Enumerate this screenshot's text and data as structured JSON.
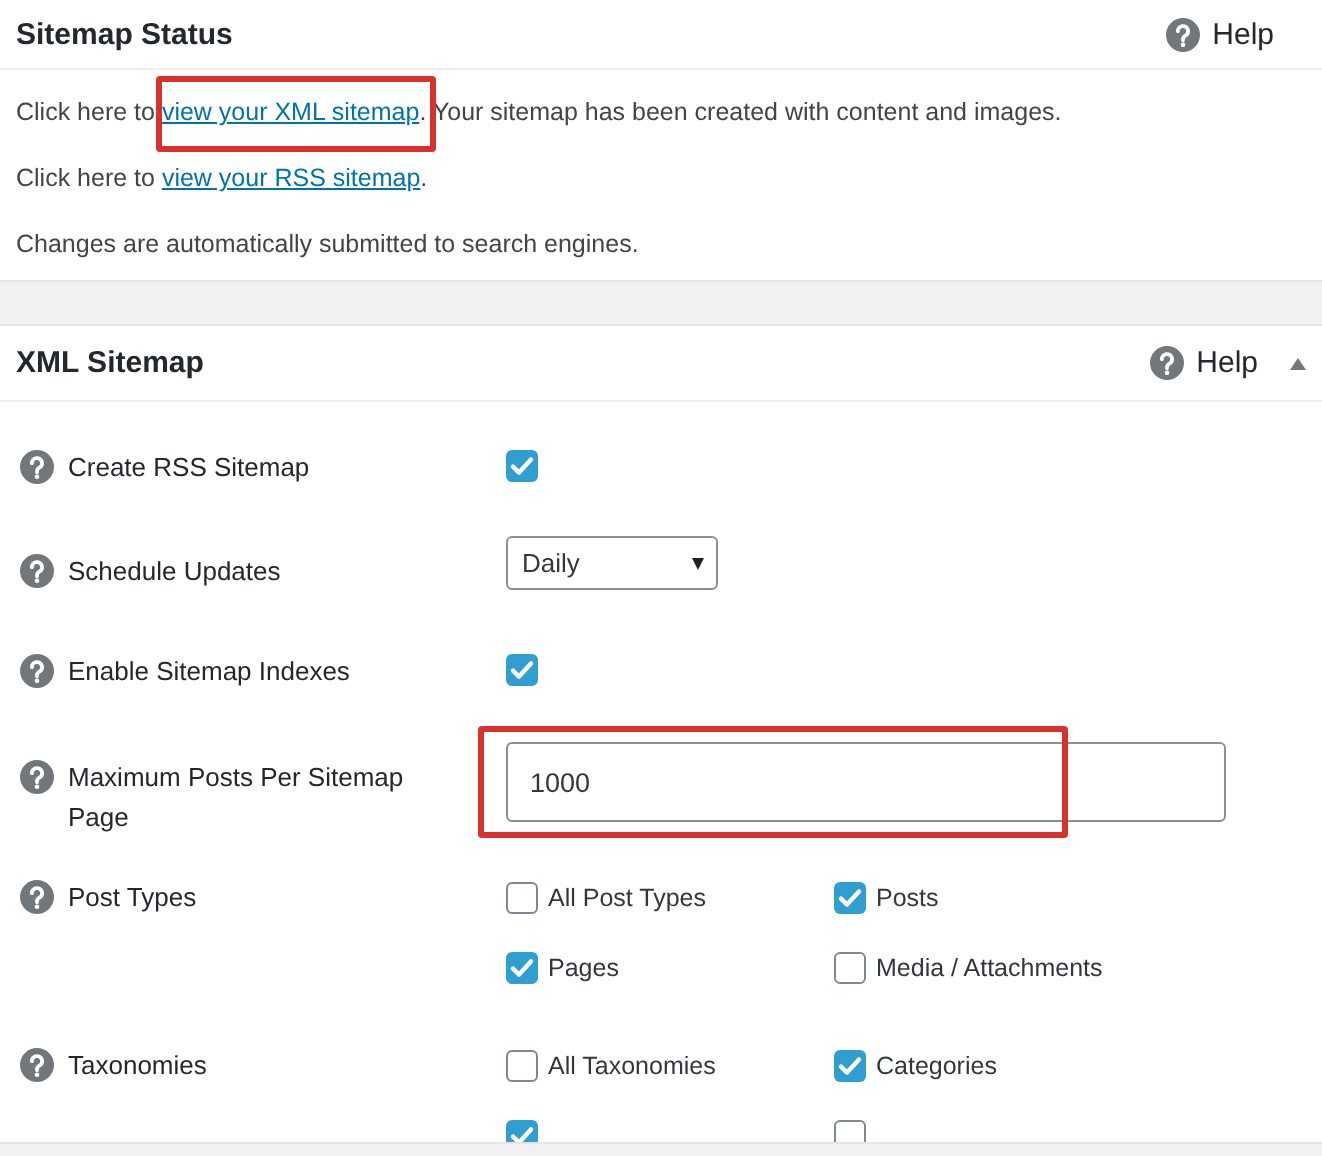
{
  "status_panel": {
    "title": "Sitemap Status",
    "help": "Help",
    "lines": [
      {
        "prefix": "Click here to ",
        "link": "view your XML sitemap",
        "suffix": ". Your sitemap has been created with content and images.",
        "highlighted": true
      },
      {
        "prefix": "Click here to ",
        "link": "view your RSS sitemap",
        "suffix": ".",
        "highlighted": false
      },
      {
        "prefix": "Changes are automatically submitted to search engines."
      }
    ]
  },
  "xml_panel": {
    "title": "XML Sitemap",
    "help": "Help",
    "expanded": true,
    "settings": [
      {
        "kind": "checkbox",
        "label": "Create RSS Sitemap",
        "checked": true
      },
      {
        "kind": "select",
        "label": "Schedule Updates",
        "value": "Daily"
      },
      {
        "kind": "checkbox",
        "label": "Enable Sitemap Indexes",
        "checked": true
      },
      {
        "kind": "text",
        "label": "Maximum Posts Per Sitemap Page",
        "value": "1000",
        "highlighted": true
      },
      {
        "kind": "checkgroup",
        "label": "Post Types",
        "options": [
          {
            "label": "All Post Types",
            "checked": false
          },
          {
            "label": "Posts",
            "checked": true
          },
          {
            "label": "Pages",
            "checked": true
          },
          {
            "label": "Media / Attachments",
            "checked": false
          }
        ]
      },
      {
        "kind": "checkgroup",
        "label": "Taxonomies",
        "options": [
          {
            "label": "All Taxonomies",
            "checked": false
          },
          {
            "label": "Categories",
            "checked": true
          },
          {
            "checked": true
          },
          {
            "checked": false
          }
        ]
      }
    ]
  }
}
